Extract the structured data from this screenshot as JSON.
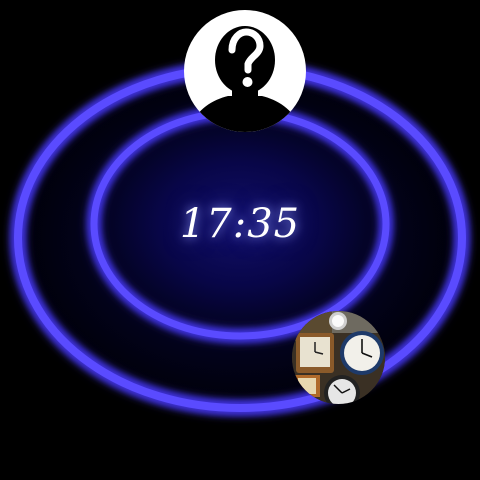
{
  "clock": {
    "time": "17:35"
  },
  "colors": {
    "background": "#000000",
    "ring_glow": "#3a2cff",
    "ring_core": "#6a5cff",
    "inner_fill": "#0a0850",
    "time_text": "#ffffff"
  },
  "contact": {
    "placeholder_glyph": "?",
    "icon": "unknown-contact-icon"
  },
  "photo": {
    "icon": "clocks-photo-thumbnail"
  }
}
